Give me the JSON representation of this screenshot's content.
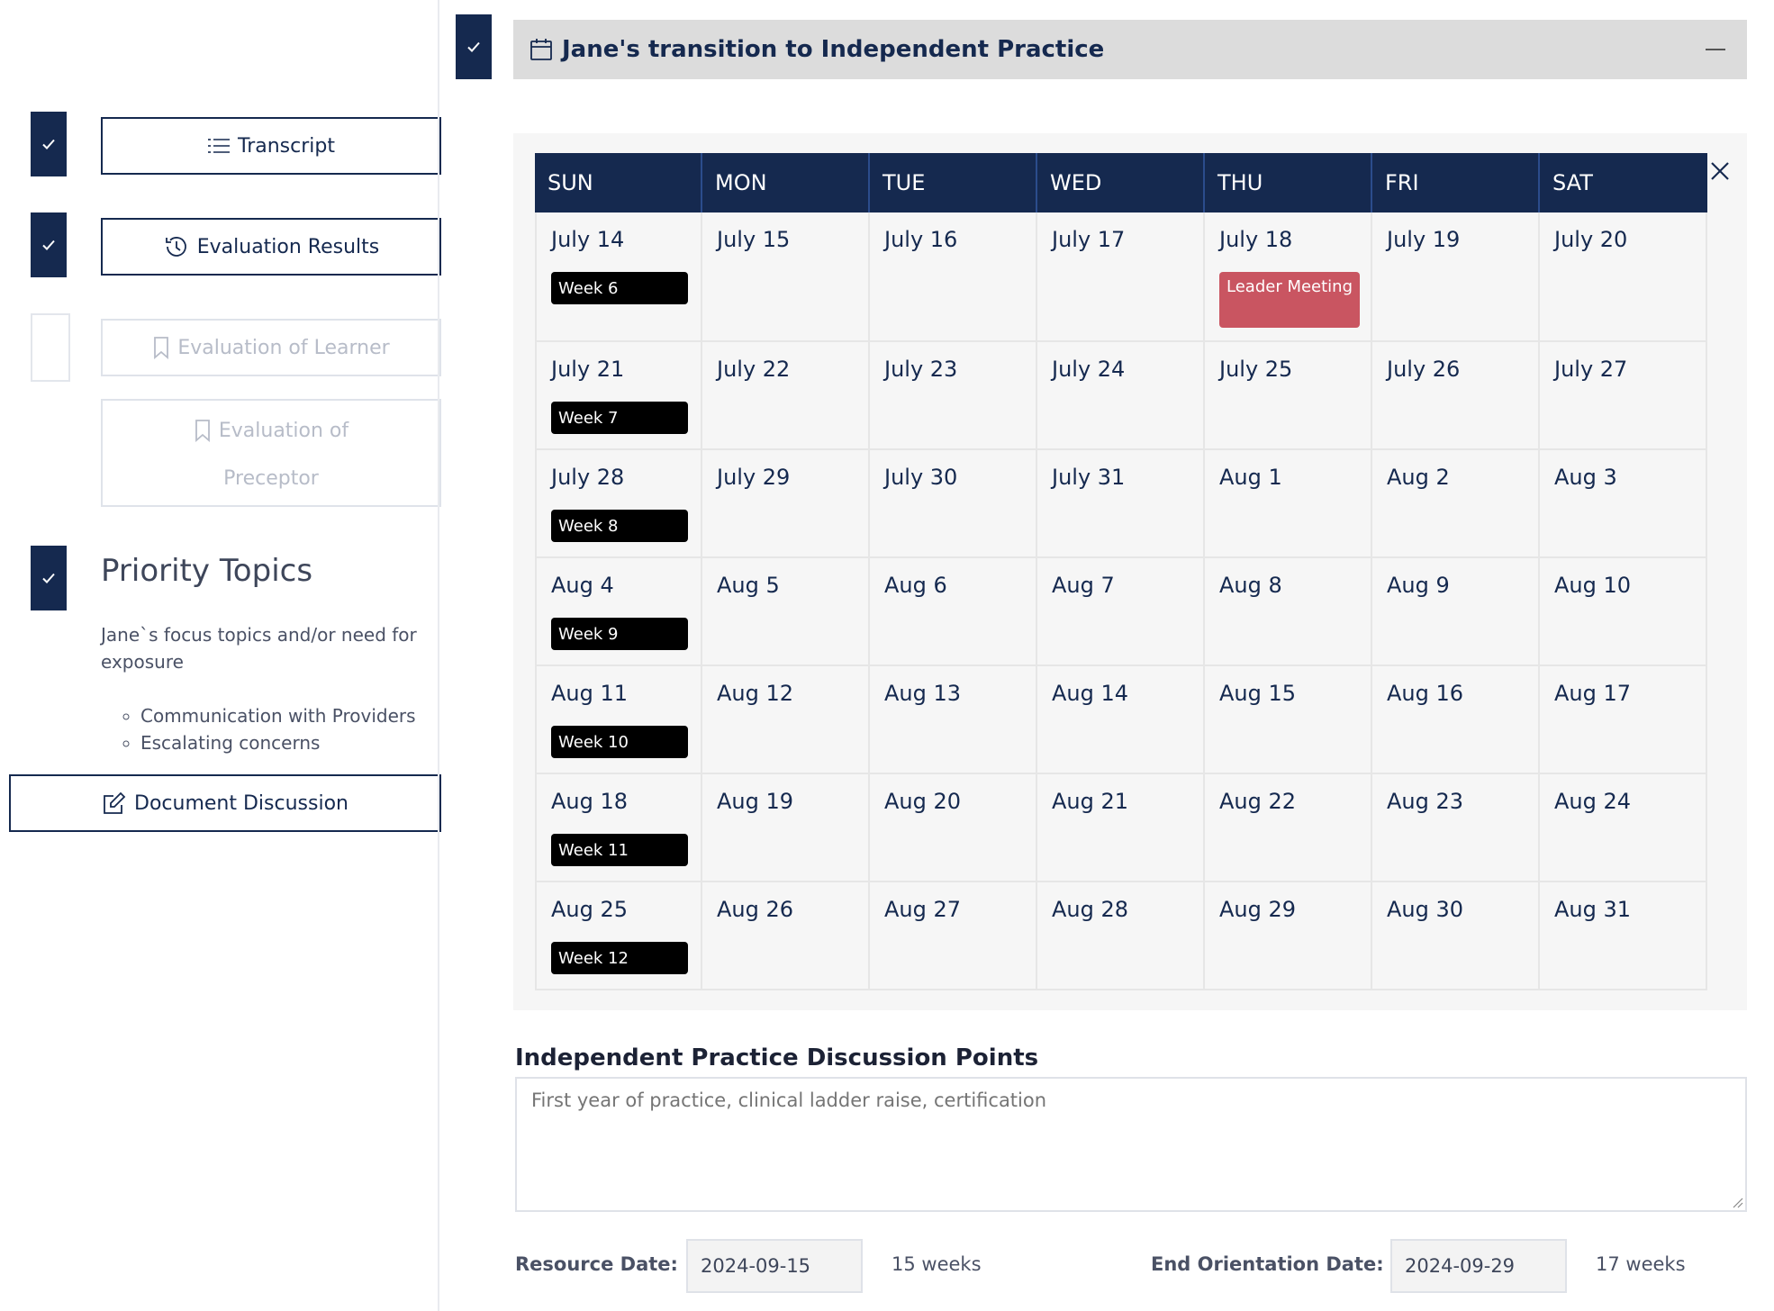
{
  "sidebar": {
    "transcript_label": "Transcript",
    "evaluation_results_label": "Evaluation Results",
    "evaluation_of_learner_label": "Evaluation of Learner",
    "evaluation_of_preceptor_label_1": "Evaluation of",
    "evaluation_of_preceptor_label_2": "Preceptor",
    "priority_topics": {
      "title": "Priority Topics",
      "description": "Jane`s focus topics and/or need for exposure",
      "items": [
        "Communication with Providers",
        "Escalating concerns"
      ]
    },
    "document_discussion_label": "Document Discussion"
  },
  "section": {
    "title": "Jane's transition to Independent Practice"
  },
  "calendar": {
    "days": [
      "SUN",
      "MON",
      "TUE",
      "WED",
      "THU",
      "FRI",
      "SAT"
    ],
    "weeks": [
      {
        "badge": "Week 6",
        "dates": [
          "July 14",
          "July 15",
          "July 16",
          "July 17",
          "July 18",
          "July 19",
          "July 20"
        ]
      },
      {
        "badge": "Week 7",
        "dates": [
          "July 21",
          "July 22",
          "July 23",
          "July 24",
          "July 25",
          "July 26",
          "July 27"
        ]
      },
      {
        "badge": "Week 8",
        "dates": [
          "July 28",
          "July 29",
          "July 30",
          "July 31",
          "Aug 1",
          "Aug 2",
          "Aug 3"
        ]
      },
      {
        "badge": "Week 9",
        "dates": [
          "Aug 4",
          "Aug 5",
          "Aug 6",
          "Aug 7",
          "Aug 8",
          "Aug 9",
          "Aug 10"
        ]
      },
      {
        "badge": "Week 10",
        "dates": [
          "Aug 11",
          "Aug 12",
          "Aug 13",
          "Aug 14",
          "Aug 15",
          "Aug 16",
          "Aug 17"
        ]
      },
      {
        "badge": "Week 11",
        "dates": [
          "Aug 18",
          "Aug 19",
          "Aug 20",
          "Aug 21",
          "Aug 22",
          "Aug 23",
          "Aug 24"
        ]
      },
      {
        "badge": "Week 12",
        "dates": [
          "Aug 25",
          "Aug 26",
          "Aug 27",
          "Aug 28",
          "Aug 29",
          "Aug 30",
          "Aug 31"
        ]
      }
    ],
    "events": [
      {
        "week": 0,
        "day": 4,
        "label": "Leader Meeting",
        "color": "#c95561"
      }
    ]
  },
  "discussion": {
    "label": "Independent Practice Discussion Points",
    "placeholder": "First year of practice, clinical ladder raise, certification"
  },
  "dates": {
    "resource_label": "Resource Date:",
    "resource_value": "2024-09-15",
    "resource_weeks": "15 weeks",
    "end_label": "End Orientation Date:",
    "end_value": "2024-09-29",
    "end_weeks": "17 weeks"
  },
  "colors": {
    "navy": "#15294f",
    "event_red": "#c95561",
    "header_gray": "#dcdcdc"
  }
}
